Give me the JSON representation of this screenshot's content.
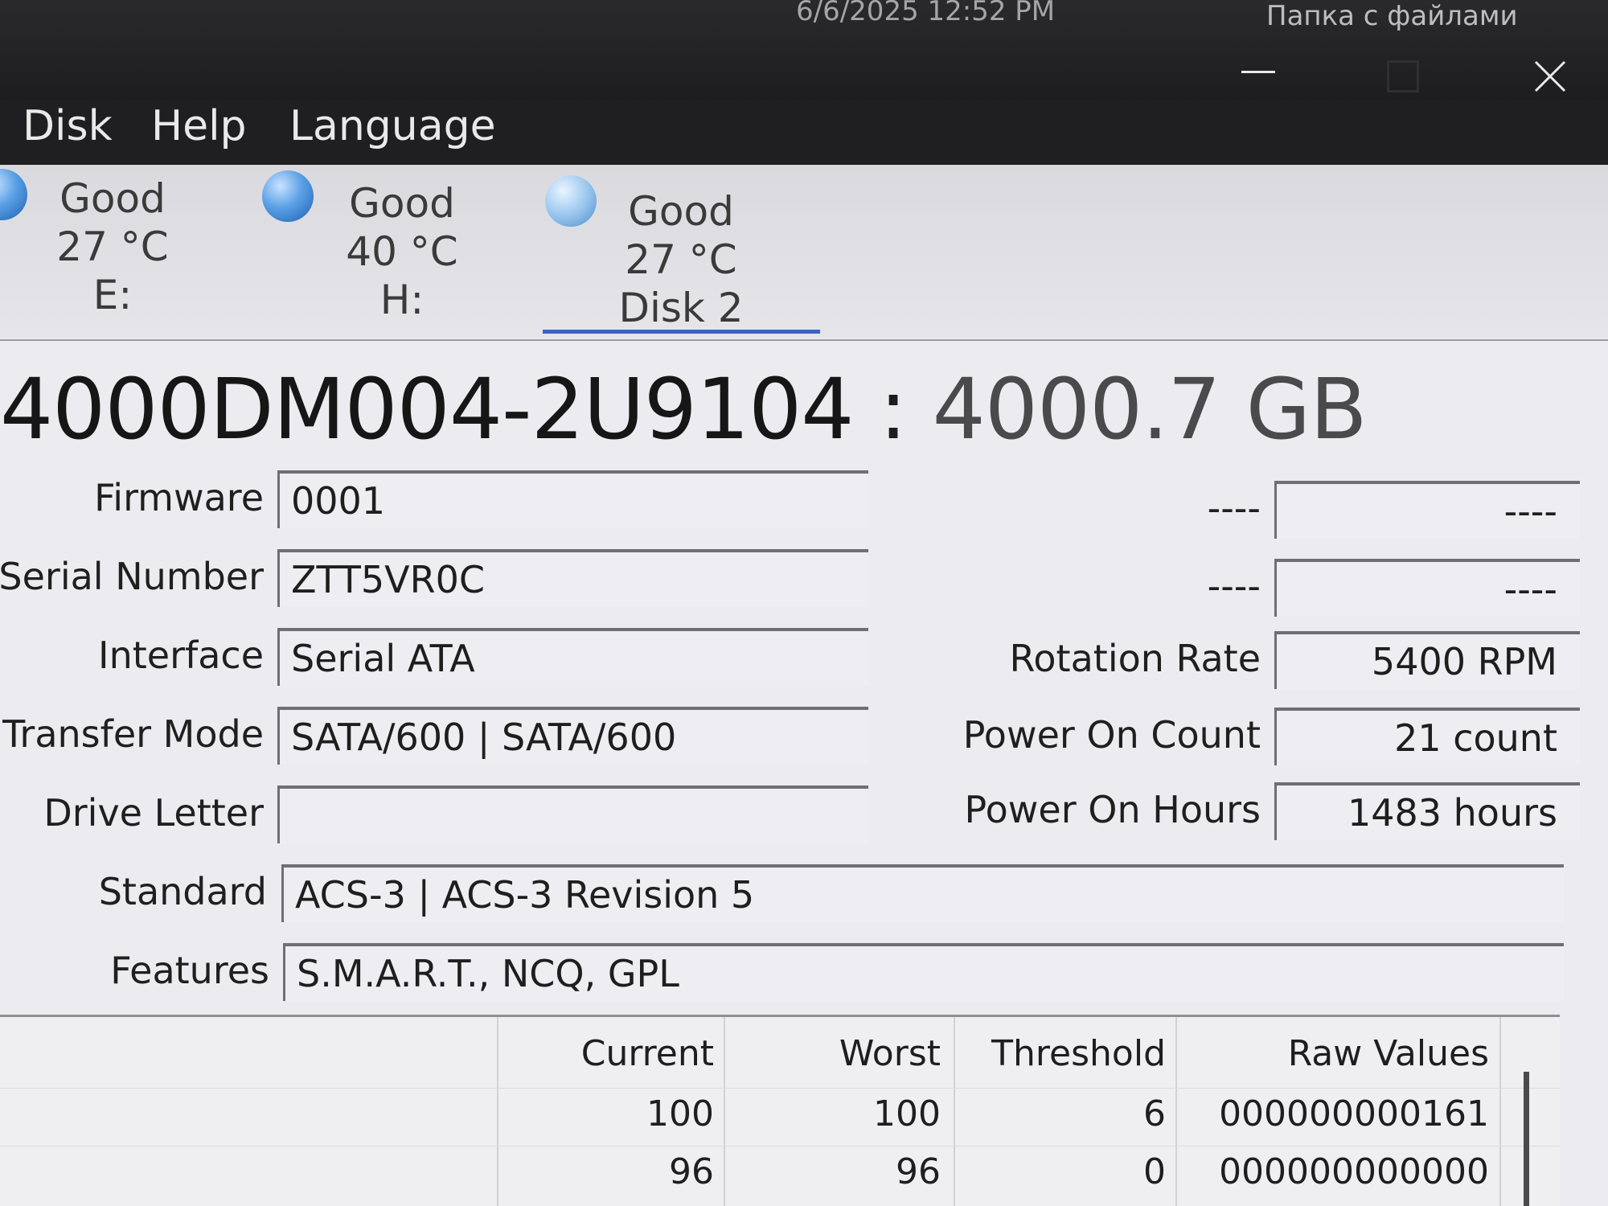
{
  "titlebar": {
    "clock": "6/6/2025 12:52 PM",
    "folder_caption": "Папка с файлами",
    "min_icon": "minimize-icon",
    "max_icon": "maximize-icon",
    "close_icon": "close-icon"
  },
  "menu": {
    "items": [
      {
        "label": "Disk"
      },
      {
        "label": "Help"
      },
      {
        "label": "Language"
      }
    ]
  },
  "disks": [
    {
      "status": "Good",
      "temp": "27 °C",
      "name": "E:",
      "icon": "health-status-icon"
    },
    {
      "status": "Good",
      "temp": "40 °C",
      "name": "H:",
      "icon": "health-status-icon"
    },
    {
      "status": "Good",
      "temp": "27 °C",
      "name": "Disk 2",
      "icon": "health-status-icon",
      "selected": true
    }
  ],
  "drive": {
    "model": "4000DM004-2U9104",
    "separator": ":",
    "capacity": "4000.7 GB"
  },
  "info_left": [
    {
      "label": "Firmware",
      "value": "0001"
    },
    {
      "label": "Serial Number",
      "value": "ZTT5VR0C"
    },
    {
      "label": "Interface",
      "value": "Serial ATA"
    },
    {
      "label": "Transfer Mode",
      "value": "SATA/600 | SATA/600"
    },
    {
      "label": "Drive Letter",
      "value": ""
    },
    {
      "label": "Standard",
      "value": "ACS-3 | ACS-3 Revision 5"
    },
    {
      "label": "Features",
      "value": "S.M.A.R.T., NCQ, GPL"
    }
  ],
  "info_right": [
    {
      "label": "----",
      "value": "----"
    },
    {
      "label": "----",
      "value": "----"
    },
    {
      "label": "Rotation Rate",
      "value": "5400 RPM"
    },
    {
      "label": "Power On Count",
      "value": "21 count"
    },
    {
      "label": "Power On Hours",
      "value": "1483 hours"
    }
  ],
  "smart": {
    "headers": [
      "Current",
      "Worst",
      "Threshold",
      "Raw Values"
    ],
    "rows": [
      [
        "100",
        "100",
        "6",
        "000000000161"
      ],
      [
        "96",
        "96",
        "0",
        "000000000000"
      ]
    ]
  },
  "colors": {
    "titlebar_bg": "#1f1f21",
    "tab_selected_underline": "#3e62c9",
    "status_good": "#5aa0e6"
  }
}
